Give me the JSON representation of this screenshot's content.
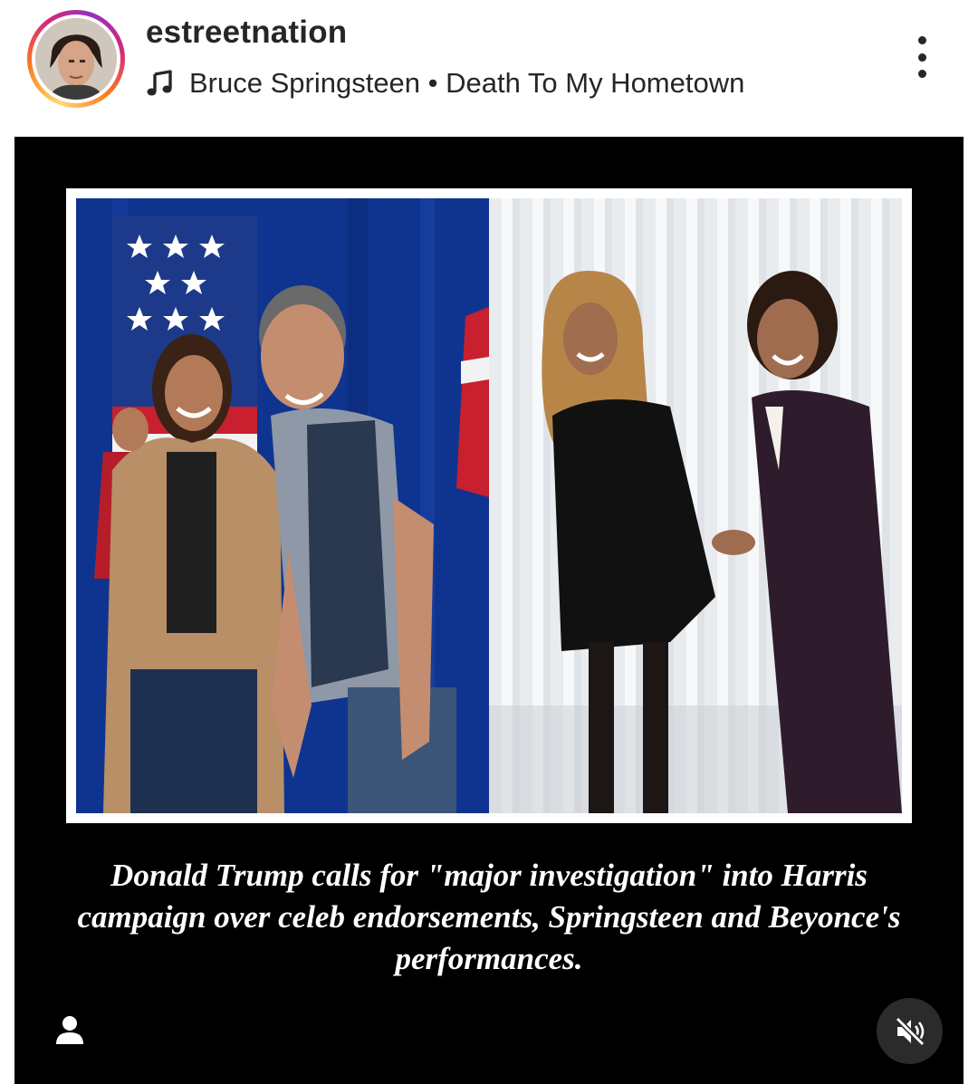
{
  "header": {
    "username": "estreetnation",
    "audio": {
      "icon": "music-note-icon",
      "text": "Bruce Springsteen • Death To My Hometown"
    },
    "more_icon": "more-vertical-icon",
    "story_ring_colors": [
      "#feda75",
      "#fa7e1e",
      "#d62976",
      "#962fbf"
    ]
  },
  "post": {
    "background": "#000000",
    "caption": "Donald Trump calls for \"major investigation\" into Harris campaign over celeb endorsements, Springsteen and Beyonce's performances.",
    "tagged_icon": "user-tag-icon",
    "mute_icon": "speaker-muted-icon"
  }
}
